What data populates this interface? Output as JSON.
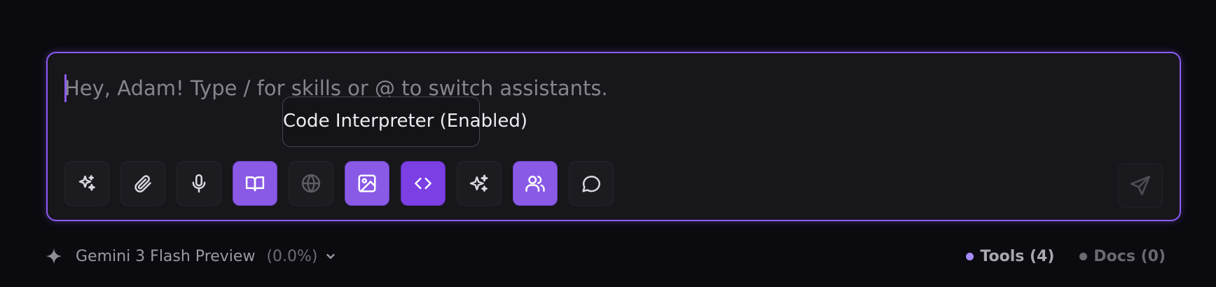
{
  "composer": {
    "placeholder": "Hey, Adam! Type / for skills or @ to switch assistants.",
    "value": "",
    "accent_color": "#8b5cf6"
  },
  "tooltip": {
    "text": "Code Interpreter (Enabled)"
  },
  "toolbar": {
    "buttons": [
      {
        "icon": "sparkles-icon",
        "active": false
      },
      {
        "icon": "paperclip-icon",
        "active": false
      },
      {
        "icon": "microphone-icon",
        "active": false
      },
      {
        "icon": "book-icon",
        "active": true
      },
      {
        "icon": "globe-icon",
        "active": false
      },
      {
        "icon": "image-icon",
        "active": true
      },
      {
        "icon": "code-icon",
        "active": true
      },
      {
        "icon": "magic-sparkles-icon",
        "active": false
      },
      {
        "icon": "users-icon",
        "active": true
      },
      {
        "icon": "chat-bubble-icon",
        "active": false
      }
    ],
    "send_icon": "send-icon"
  },
  "model": {
    "icon": "sparkle-icon",
    "name": "Gemini 3 Flash Preview",
    "usage": "(0.0%)"
  },
  "status": {
    "tools_label": "Tools (4)",
    "tools_color": "#a78bfa",
    "docs_label": "Docs (0)",
    "docs_color": "#6b6a70"
  }
}
